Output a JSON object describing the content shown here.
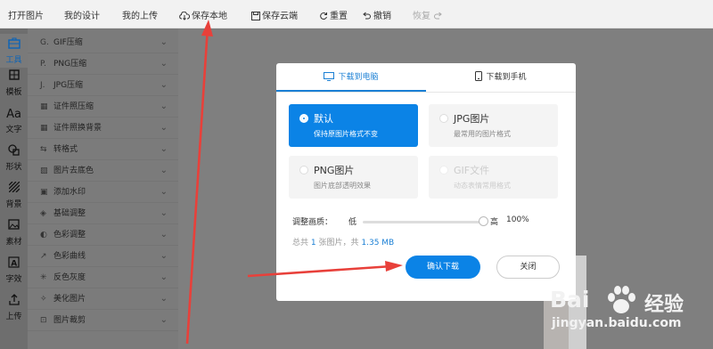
{
  "toolbar": {
    "open": "打开图片",
    "my_designs": "我的设计",
    "my_uploads": "我的上传",
    "save_local": "保存本地",
    "save_cloud": "保存云端",
    "reset": "重置",
    "undo": "撤销",
    "redo": "恢复"
  },
  "rail": [
    {
      "label": "工具",
      "icon": "toolbox-icon"
    },
    {
      "label": "模板",
      "icon": "template-icon"
    },
    {
      "label": "文字",
      "icon": "text-icon"
    },
    {
      "label": "形状",
      "icon": "shape-icon"
    },
    {
      "label": "背景",
      "icon": "background-icon"
    },
    {
      "label": "素材",
      "icon": "image-icon"
    },
    {
      "label": "字效",
      "icon": "text-effect-icon"
    },
    {
      "label": "上传",
      "icon": "upload-icon"
    }
  ],
  "menu": [
    {
      "prefix": "G.",
      "label": "GIF压缩"
    },
    {
      "prefix": "P.",
      "label": "PNG压缩"
    },
    {
      "prefix": "J.",
      "label": "JPG压缩"
    },
    {
      "prefix": "▦",
      "label": "证件照压缩"
    },
    {
      "prefix": "▦",
      "label": "证件照换背景"
    },
    {
      "prefix": "⇆",
      "label": "转格式"
    },
    {
      "prefix": "▨",
      "label": "图片去底色"
    },
    {
      "prefix": "▣",
      "label": "添加水印"
    },
    {
      "prefix": "◈",
      "label": "基础调整"
    },
    {
      "prefix": "◐",
      "label": "色彩调整"
    },
    {
      "prefix": "↗",
      "label": "色彩曲线"
    },
    {
      "prefix": "✳",
      "label": "反色灰度"
    },
    {
      "prefix": "✧",
      "label": "美化图片"
    },
    {
      "prefix": "⊡",
      "label": "图片裁剪"
    }
  ],
  "dialog": {
    "tab_pc": "下载到电脑",
    "tab_phone": "下载到手机",
    "options": [
      {
        "title": "默认",
        "sub": "保持原图片格式不变",
        "state": "selected"
      },
      {
        "title": "JPG图片",
        "sub": "最常用的图片格式",
        "state": "normal"
      },
      {
        "title": "PNG图片",
        "sub": "图片底部透明效果",
        "state": "normal"
      },
      {
        "title": "GIF文件",
        "sub": "动态表情常用格式",
        "state": "disabled"
      }
    ],
    "quality_label": "调整画质：",
    "quality_low": "低",
    "quality_high": "高",
    "quality_value": "100%",
    "quality_fraction": 1.0,
    "summary_prefix": "总共",
    "summary_count": "1",
    "summary_mid": "张图片，共",
    "summary_size": "1.35 MB",
    "confirm": "确认下载",
    "close": "关闭"
  },
  "watermark": {
    "brand": "Bai",
    "brand2": "经验",
    "url": "jingyan.baidu.com"
  },
  "colors": {
    "accent": "#0b83e6",
    "arrow": "#e8403a"
  }
}
